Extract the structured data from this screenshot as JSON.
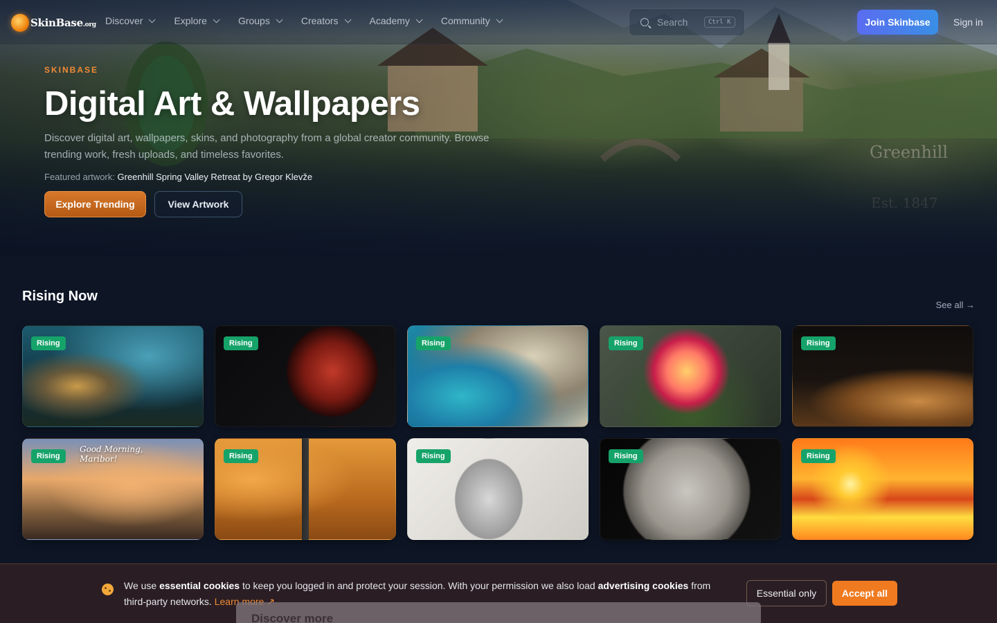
{
  "nav": {
    "logo_text": "SkinBase",
    "logo_tld": ".org",
    "links": [
      {
        "label": "Discover"
      },
      {
        "label": "Explore"
      },
      {
        "label": "Groups"
      },
      {
        "label": "Creators"
      },
      {
        "label": "Academy"
      },
      {
        "label": "Community"
      }
    ],
    "search_placeholder": "Search",
    "search_shortcut": "Ctrl K",
    "join_label": "Join Skinbase",
    "signin_label": "Sign in"
  },
  "hero": {
    "eyebrow": "SKINBASE",
    "title": "Digital Art & Wallpapers",
    "description": "Discover digital art, wallpapers, skins, and photography from a global creator community. Browse trending work, fresh uploads, and timeless favorites.",
    "featured_prefix": "Featured artwork:",
    "featured_title": "Greenhill Spring Valley Retreat",
    "featured_by": "by",
    "featured_author": "Gregor Klevže",
    "primary_button": "Explore Trending",
    "secondary_button": "View Artwork",
    "image_signs": [
      "Greenhill",
      "Est. 1847"
    ]
  },
  "rising": {
    "title": "Rising Now",
    "see_all": "See all →",
    "badge_label": "Rising",
    "cards": [
      {
        "icon": "submarine-art"
      },
      {
        "icon": "red-planet-art"
      },
      {
        "icon": "coastline-aerial-art"
      },
      {
        "icon": "rose-art"
      },
      {
        "icon": "sand-dune-art"
      },
      {
        "icon": "maribor-cafe-art",
        "overlay_text": "Good Morning, Maribor!"
      },
      {
        "icon": "desert-road-art"
      },
      {
        "icon": "pencil-portrait-art"
      },
      {
        "icon": "moon-art"
      },
      {
        "icon": "tropical-sunset-art"
      }
    ]
  },
  "cookie": {
    "text_1": "We use",
    "bold_1": "essential cookies",
    "text_2": "to keep you logged in and protect your session. With your permission we also load",
    "bold_2": "advertising cookies",
    "text_3": "from third-party networks.",
    "learn_more": "Learn more ↗",
    "essential_button": "Essential only",
    "accept_button": "Accept all"
  },
  "discover_more": "Discover more"
}
